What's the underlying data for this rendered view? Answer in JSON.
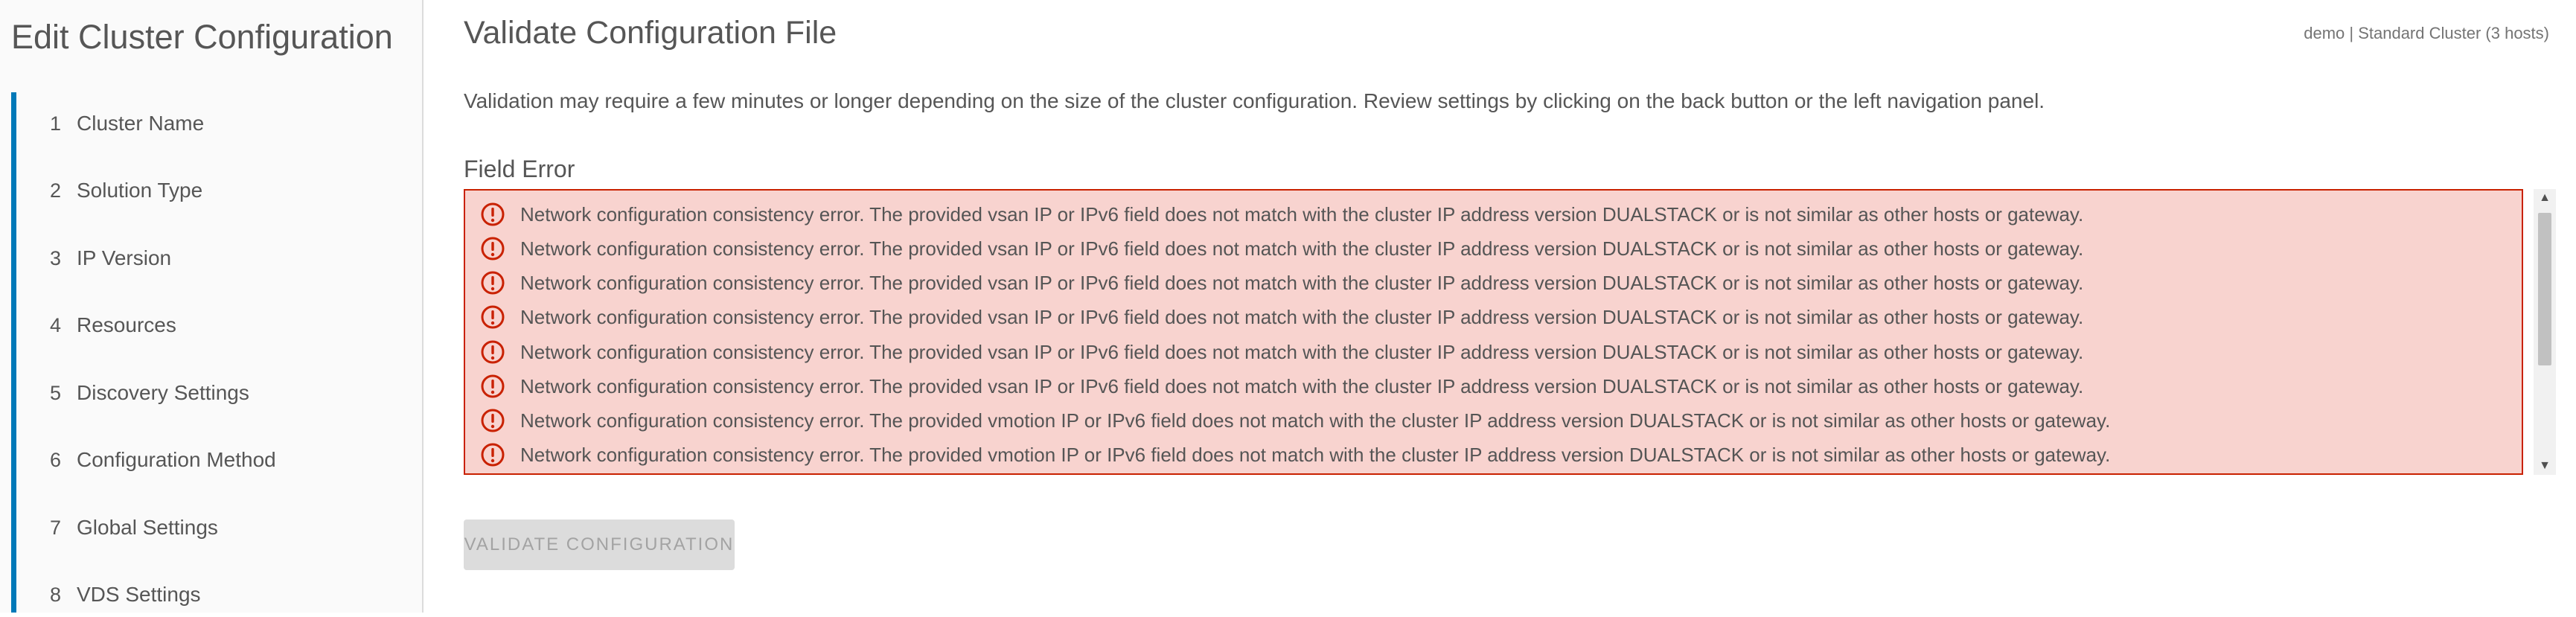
{
  "sidebar": {
    "title": "Edit Cluster Configuration",
    "accent_color": "#0079b8",
    "steps": [
      {
        "number": "1",
        "label": "Cluster Name"
      },
      {
        "number": "2",
        "label": "Solution Type"
      },
      {
        "number": "3",
        "label": "IP Version"
      },
      {
        "number": "4",
        "label": "Resources"
      },
      {
        "number": "5",
        "label": "Discovery Settings"
      },
      {
        "number": "6",
        "label": "Configuration Method"
      },
      {
        "number": "7",
        "label": "Global Settings"
      },
      {
        "number": "8",
        "label": "VDS Settings"
      }
    ]
  },
  "main": {
    "title": "Validate Configuration File",
    "context_info": "demo | Standard Cluster (3 hosts)",
    "description": "Validation may require a few minutes or longer depending on the size of the cluster configuration. Review settings by clicking on the back button or the left navigation panel.",
    "field_error": {
      "label": "Field Error",
      "background_color": "#f8d3cf",
      "border_color": "#c92100",
      "icon": "error-circle-icon",
      "errors": [
        "Network configuration consistency error. The provided vsan IP or IPv6 field does not match with the cluster IP address version DUALSTACK or is not similar as other hosts or gateway.",
        "Network configuration consistency error. The provided vsan IP or IPv6 field does not match with the cluster IP address version DUALSTACK or is not similar as other hosts or gateway.",
        "Network configuration consistency error. The provided vsan IP or IPv6 field does not match with the cluster IP address version DUALSTACK or is not similar as other hosts or gateway.",
        "Network configuration consistency error. The provided vsan IP or IPv6 field does not match with the cluster IP address version DUALSTACK or is not similar as other hosts or gateway.",
        "Network configuration consistency error. The provided vsan IP or IPv6 field does not match with the cluster IP address version DUALSTACK or is not similar as other hosts or gateway.",
        "Network configuration consistency error. The provided vsan IP or IPv6 field does not match with the cluster IP address version DUALSTACK or is not similar as other hosts or gateway.",
        "Network configuration consistency error. The provided vmotion IP or IPv6 field does not match with the cluster IP address version DUALSTACK or is not similar as other hosts or gateway.",
        "Network configuration consistency error. The provided vmotion IP or IPv6 field does not match with the cluster IP address version DUALSTACK or is not similar as other hosts or gateway."
      ]
    },
    "validate_button_label": "VALIDATE CONFIGURATION",
    "validate_button_enabled": false
  }
}
